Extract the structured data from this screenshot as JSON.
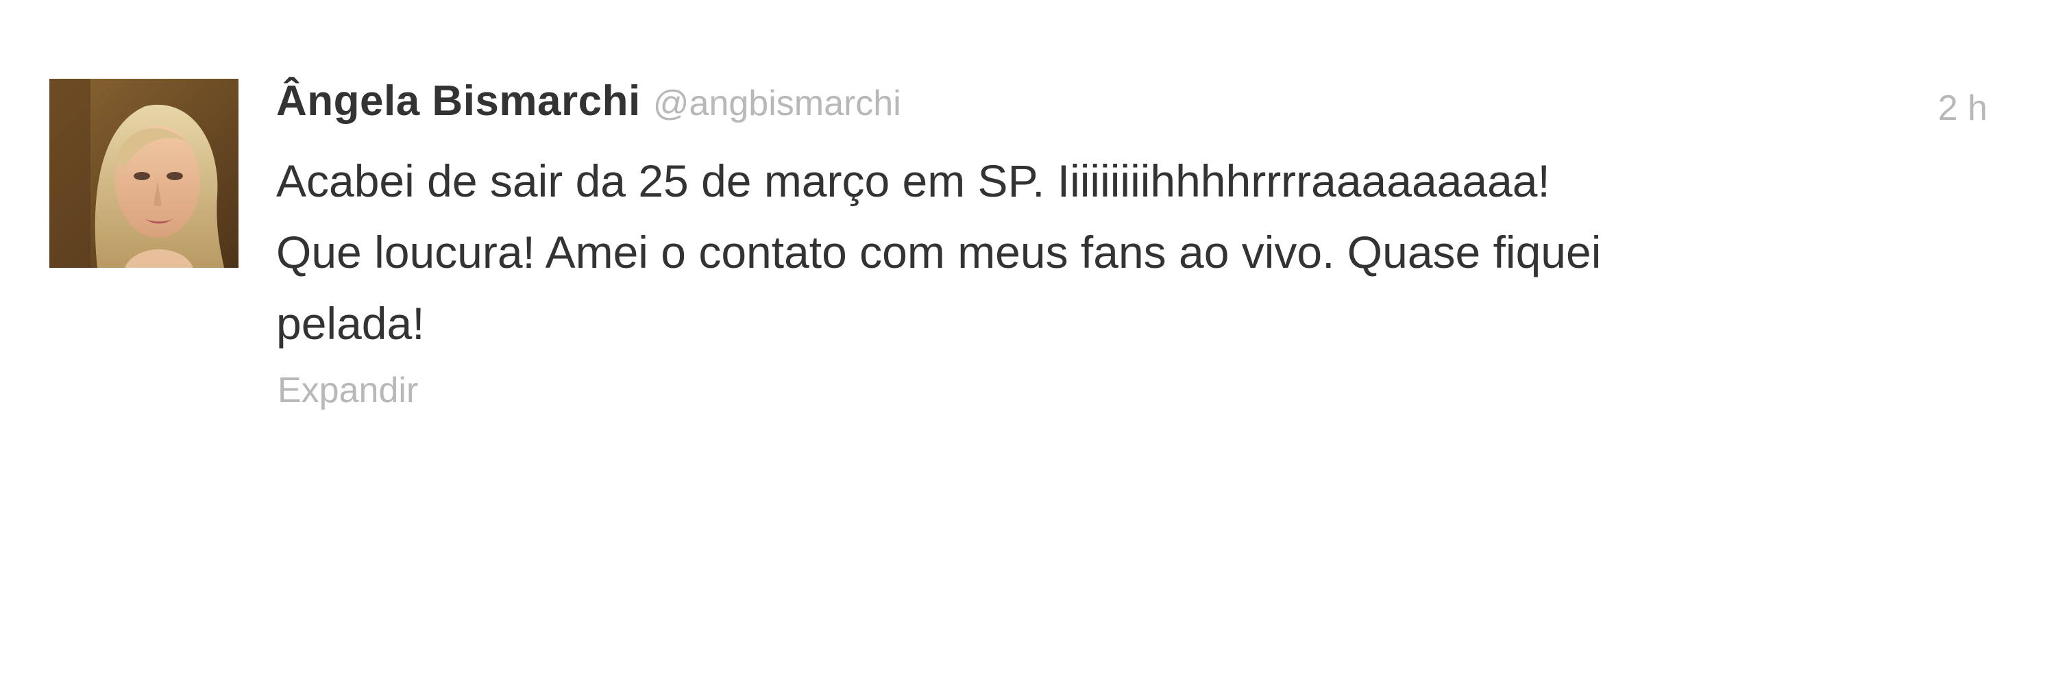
{
  "tweet": {
    "author": {
      "display_name": "Ângela Bismarchi",
      "handle": "@angbismarchi"
    },
    "timestamp": "2 h",
    "text_lines": [
      "Acabei de sair da 25 de março em SP. Iiiiiiiiihhhhrrrraaaaaaaaa!",
      "Que loucura! Amei o contato com meus fans ao vivo. Quase fiquei",
      "pelada!"
    ],
    "expand_label": "Expandir"
  }
}
